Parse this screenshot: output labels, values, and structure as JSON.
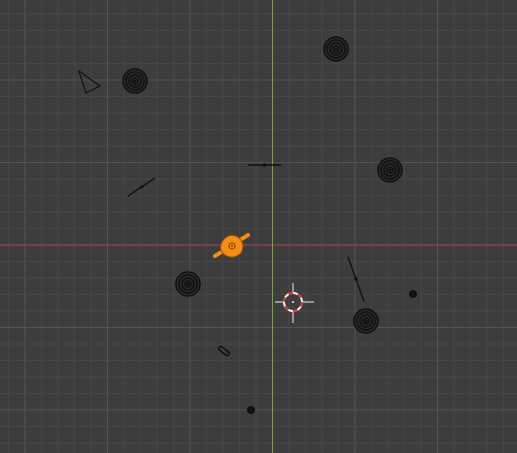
{
  "viewport": {
    "mode": "top-orthographic",
    "colors": {
      "background": "#3d3d3d",
      "grid_minor": "#464646",
      "grid_major": "#545454",
      "axis_x": "#b04854",
      "axis_y": "#7fa33a",
      "object_dark": "#111111",
      "selected": "#f28e18",
      "selected_dark": "#9a4f00",
      "cursor_red": "#e03030",
      "cursor_white": "#f0f0f0"
    }
  },
  "objects": [
    {
      "name": "camera-object",
      "kind": "camera",
      "selected": false
    },
    {
      "name": "sphere-object",
      "kind": "sphere",
      "selected": false
    },
    {
      "name": "sphere-object",
      "kind": "sphere",
      "selected": false
    },
    {
      "name": "sphere-object",
      "kind": "sphere",
      "selected": false
    },
    {
      "name": "sphere-object",
      "kind": "sphere",
      "selected": false
    },
    {
      "name": "sphere-object",
      "kind": "sphere",
      "selected": false
    },
    {
      "name": "line-object",
      "kind": "line",
      "selected": false
    },
    {
      "name": "line-object",
      "kind": "line",
      "selected": false
    },
    {
      "name": "line-object",
      "kind": "line",
      "selected": false
    },
    {
      "name": "small-mesh-object",
      "kind": "small-mesh",
      "selected": false
    },
    {
      "name": "dot-object",
      "kind": "dot",
      "selected": false
    },
    {
      "name": "dot-object",
      "kind": "dot",
      "selected": false
    },
    {
      "name": "selected-object",
      "kind": "mesh",
      "selected": true
    }
  ],
  "cursor": {
    "name": "3d-cursor",
    "visible": true
  }
}
